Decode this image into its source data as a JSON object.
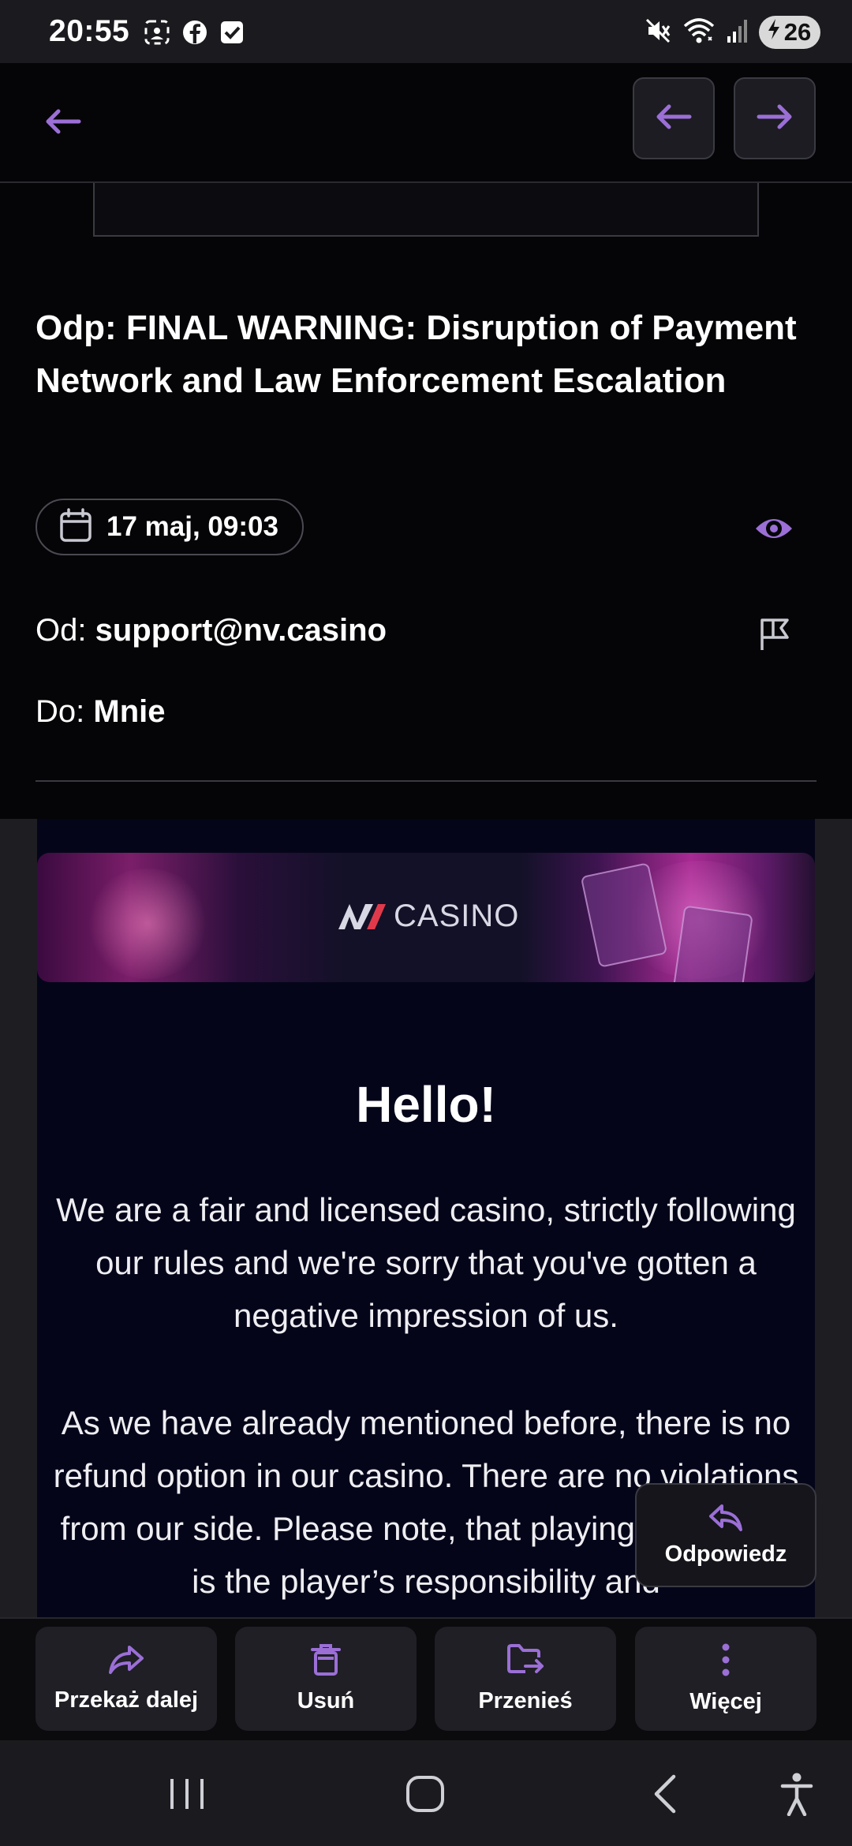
{
  "status_bar": {
    "time": "20:55",
    "battery": "26",
    "icons_left": [
      "screenshot-icon",
      "facebook-icon",
      "checkbox-icon"
    ],
    "icons_right": [
      "mute-icon",
      "wifi-icon",
      "signal-icon",
      "battery-charging-icon"
    ]
  },
  "app_bar": {
    "back_icon": "arrow-left-icon",
    "prev_icon": "arrow-left-icon",
    "next_icon": "arrow-right-icon"
  },
  "email": {
    "subject": "Odp: FINAL WARNING: Disruption of Payment Network and Law Enforcement Escalation",
    "date": "17 maj, 09:03",
    "from_label": "Od:",
    "from_value": "support@nv.casino",
    "to_label": "Do:",
    "to_value": "Mnie"
  },
  "body": {
    "banner_logo_text": "CASINO",
    "greeting": "Hello!",
    "paragraph_1": "We are a fair and licensed casino, strictly following our rules and we're sorry that you've gotten a negative impression of us.",
    "paragraph_2": "As we have already mentioned before, there is no refund option in our casino. There are no violations from our side. Please note, that playing for money is the player’s responsibility and"
  },
  "reply_button": {
    "label": "Odpowiedz"
  },
  "actions": [
    {
      "label": "Przekaż dalej",
      "icon": "forward-icon"
    },
    {
      "label": "Usuń",
      "icon": "trash-icon"
    },
    {
      "label": "Przenieś",
      "icon": "move-folder-icon"
    },
    {
      "label": "Więcej",
      "icon": "more-vertical-icon"
    }
  ],
  "colors": {
    "accent": "#9b6fd6",
    "background": "#050507",
    "email_body": "#05051a"
  }
}
